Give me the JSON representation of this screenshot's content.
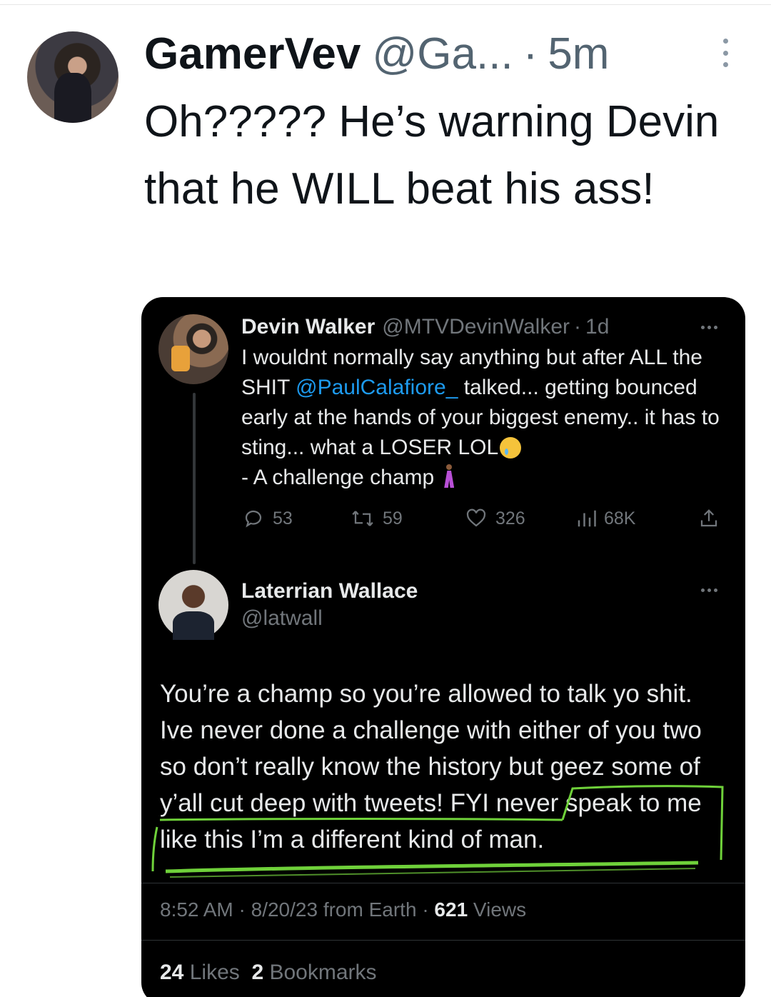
{
  "outer_tweet": {
    "display_name": "GamerVev",
    "handle": "@Ga...",
    "separator": "·",
    "time": "5m",
    "text": "Oh????? He’s warning Devin that he WILL beat his ass!"
  },
  "embedded": {
    "tweet1": {
      "name": "Devin Walker",
      "handle": "@MTVDevinWalker",
      "separator": "·",
      "time": "1d",
      "text_before_mention": "I wouldnt normally say anything but after ALL the SHIT ",
      "mention": "@PaulCalafiore_",
      "text_after_mention": " talked... getting bounced early at the hands of your biggest enemy.. it has to sting... what a LOSER LOL",
      "text_line2": "- A challenge champ",
      "replies": "53",
      "retweets": "59",
      "likes": "326",
      "views": "68K",
      "emoji_1": "crying-face",
      "emoji_2": "dancing-man"
    },
    "tweet2": {
      "name": "Laterrian Wallace",
      "handle": "@latwall",
      "text": "You’re a champ so you’re allowed to talk yo shit. Ive never done a challenge with either of you two so don’t really know the history but geez some of y’all cut deep with tweets! FYI never speak to me like this I’m a different kind of man.",
      "time": "8:52 AM",
      "separator": "·",
      "date": "8/20/23",
      "source": "from Earth",
      "views_count": "621",
      "views_label": "Views",
      "likes_count": "24",
      "likes_label": "Likes",
      "bookmarks_count": "2",
      "bookmarks_label": "Bookmarks"
    }
  },
  "colors": {
    "link": "#1d9bf0",
    "highlight": "#6fd13a",
    "embed_bg": "#000000"
  }
}
